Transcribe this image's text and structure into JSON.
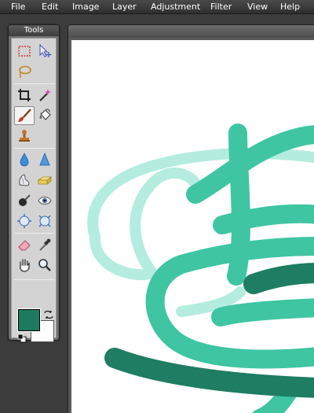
{
  "menu": {
    "items": [
      "File",
      "Edit",
      "Image",
      "Layer",
      "Adjustment",
      "Filter",
      "View",
      "Help"
    ]
  },
  "tools_panel": {
    "title": "Tools",
    "tools": [
      {
        "name": "marquee-select-tool",
        "icon": "marquee-icon"
      },
      {
        "name": "move-tool",
        "icon": "move-arrow-icon"
      },
      {
        "name": "lasso-tool",
        "icon": "lasso-icon"
      },
      {
        "name": "crop-tool",
        "icon": "crop-icon"
      },
      {
        "name": "magic-wand-tool",
        "icon": "magic-wand-icon"
      },
      {
        "name": "brush-tool",
        "icon": "brush-icon",
        "active": true
      },
      {
        "name": "eraser-shape-tool",
        "icon": "fill-bucket-icon"
      },
      {
        "name": "clone-stamp-tool",
        "icon": "stamp-icon"
      },
      {
        "name": "blur-tool",
        "icon": "drop-icon"
      },
      {
        "name": "sharpen-tool",
        "icon": "triangle-icon"
      },
      {
        "name": "smudge-tool",
        "icon": "smudge-icon"
      },
      {
        "name": "sponge-tool",
        "icon": "sponge-icon"
      },
      {
        "name": "dodge-tool",
        "icon": "dodge-icon"
      },
      {
        "name": "red-eye-tool",
        "icon": "eye-icon"
      },
      {
        "name": "bloat-tool",
        "icon": "bloat-icon"
      },
      {
        "name": "pinch-tool",
        "icon": "pinch-icon"
      },
      {
        "name": "eraser-tool",
        "icon": "eraser-icon"
      },
      {
        "name": "color-picker-tool",
        "icon": "eyedropper-icon"
      },
      {
        "name": "hand-tool",
        "icon": "hand-icon"
      },
      {
        "name": "zoom-tool",
        "icon": "magnifier-icon"
      }
    ]
  },
  "colors": {
    "foreground": "#1e7a5e",
    "background": "#ffffff",
    "stroke_light": "#b4ece0",
    "stroke_mid": "#3fc5a2",
    "stroke_dark": "#1e7d62"
  }
}
